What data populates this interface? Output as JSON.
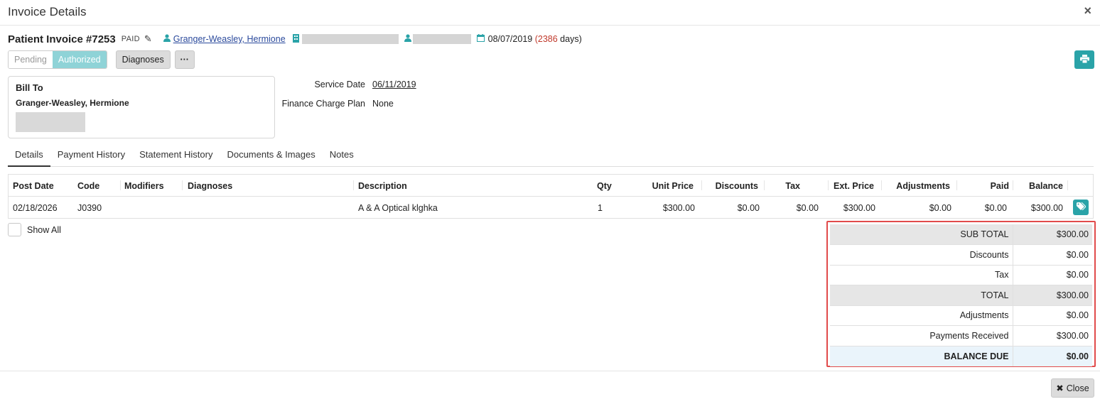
{
  "modal": {
    "title": "Invoice Details",
    "close_glyph": "×",
    "close_label": "Close",
    "close_x": "✖"
  },
  "invoice": {
    "title": "Patient Invoice #7253",
    "status": "PAID",
    "patient_name": "Granger-Weasley, Hermione",
    "date": "08/07/2019",
    "days_open": "(2386",
    "days_suffix": " days)"
  },
  "status_buttons": {
    "pending": "Pending",
    "authorized": "Authorized",
    "diagnoses": "Diagnoses",
    "more": "···"
  },
  "bill_to": {
    "heading": "Bill To",
    "name": "Granger-Weasley, Hermione"
  },
  "info": {
    "service_date_label": "Service Date",
    "service_date": "06/11/2019",
    "finance_plan_label": "Finance Charge Plan",
    "finance_plan": "None"
  },
  "tabs": [
    "Details",
    "Payment History",
    "Statement History",
    "Documents & Images",
    "Notes"
  ],
  "grid": {
    "headers": {
      "post_date": "Post Date",
      "code": "Code",
      "modifiers": "Modifiers",
      "diagnoses": "Diagnoses",
      "description": "Description",
      "qty": "Qty",
      "unit_price": "Unit Price",
      "discounts": "Discounts",
      "tax": "Tax",
      "ext_price": "Ext. Price",
      "adjustments": "Adjustments",
      "paid": "Paid",
      "balance": "Balance"
    },
    "rows": [
      {
        "post_date": "02/18/2026",
        "code": "J0390",
        "modifiers": "",
        "diagnoses": "",
        "description": "A & A Optical klghka",
        "qty": "1",
        "unit_price": "$300.00",
        "discounts": "$0.00",
        "tax": "$0.00",
        "ext_price": "$300.00",
        "adjustments": "$0.00",
        "paid": "$0.00",
        "balance": "$300.00"
      }
    ]
  },
  "show_all_label": "Show All",
  "totals": [
    {
      "label": "SUB TOTAL",
      "value": "$300.00"
    },
    {
      "label": "Discounts",
      "value": "$0.00"
    },
    {
      "label": "Tax",
      "value": "$0.00"
    },
    {
      "label": "TOTAL",
      "value": "$300.00"
    },
    {
      "label": "Adjustments",
      "value": "$0.00"
    },
    {
      "label": "Payments Received",
      "value": "$300.00"
    },
    {
      "label": "BALANCE DUE",
      "value": "$0.00"
    }
  ],
  "colors": {
    "accent": "#2aa3a8",
    "highlight_border": "#e14b4b",
    "link": "#2b4a9c",
    "days_red": "#c0392b"
  },
  "icons": {
    "edit": "pencil-icon",
    "patient": "user-icon",
    "building": "building-icon",
    "provider": "user-md-icon",
    "calendar": "calendar-icon",
    "print": "print-icon",
    "tag": "tag-icon"
  }
}
